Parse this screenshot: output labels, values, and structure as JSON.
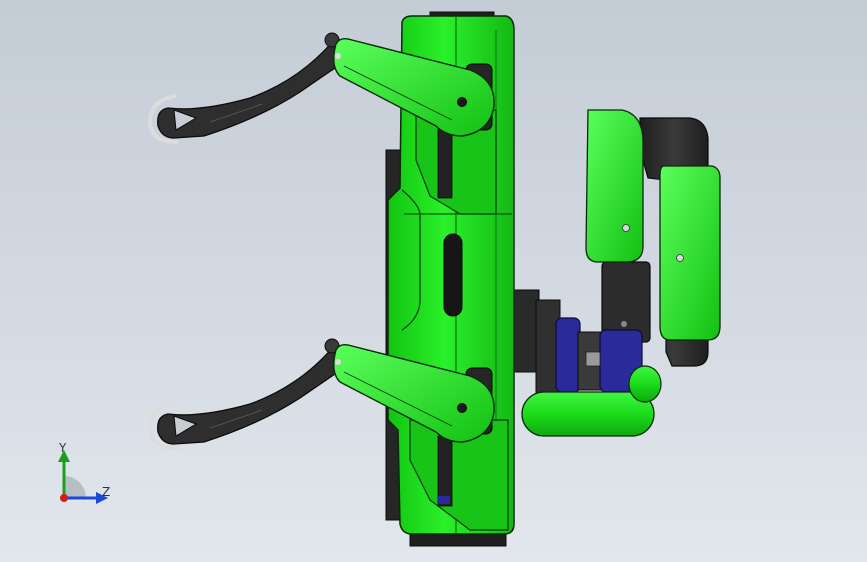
{
  "viewport": {
    "background_top": "#c4ccd6",
    "background_bottom": "#e2e7ed"
  },
  "colors": {
    "body_green": "#1fe01f",
    "edge_dark": "#0a2a0a",
    "leg_dark": "#2c2c2c",
    "motor_blue": "#2a2a9a",
    "axis_y": "#1aa01a",
    "axis_z": "#1a4ad8",
    "axis_origin": "#d81a1a"
  },
  "model": {
    "parts": [
      "main-body",
      "front-upper-leg",
      "front-lower-leg",
      "front-foot",
      "rear-upper-leg",
      "rear-lower-leg",
      "rear-foot",
      "head-bracket",
      "head-shell",
      "motor-assembly",
      "battery-cylinder"
    ]
  },
  "triad": {
    "y_label": "Y",
    "z_label": "Z",
    "icons": [
      "y-axis-arrow-icon",
      "z-axis-arrow-icon",
      "origin-dot-icon"
    ]
  }
}
